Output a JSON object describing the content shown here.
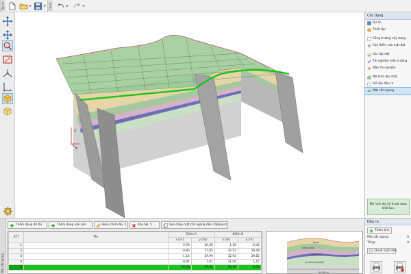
{
  "app": {
    "toolbar_tabs": [
      "Tệp tin",
      "Chỉnh"
    ],
    "toolbar_icons": [
      "new-file-icon",
      "open-folder-icon",
      "save-icon",
      "undo-icon",
      "redo-icon"
    ]
  },
  "left_tools": [
    {
      "name": "move-icon"
    },
    {
      "name": "pan-icon"
    },
    {
      "name": "zoom-window-icon"
    },
    {
      "name": "zoom-extents-icon"
    },
    {
      "name": "rotate-axes-icon"
    },
    {
      "name": "axes-xz-icon"
    },
    {
      "name": "cube-view-icon"
    },
    {
      "name": "cube-settings-icon"
    }
  ],
  "sidebar": {
    "header": "Các dạng",
    "groups": [
      [
        {
          "label": "Dự án",
          "icon": "project-icon"
        },
        {
          "label": "Thiết lập",
          "icon": "settings-icon"
        }
      ],
      [
        {
          "label": "Công trường xây dựng",
          "icon": "construction-site-icon"
        },
        {
          "label": "Các điểm của mặt đất",
          "icon": "terrain-points-icon"
        }
      ],
      [
        {
          "label": "Các lớp đất",
          "icon": "soil-layers-icon"
        },
        {
          "label": "Thí nghiệm hiện trường",
          "icon": "field-test-icon"
        },
        {
          "label": "Mẫu thí nghiệm",
          "icon": "sample-icon"
        }
      ],
      [
        {
          "label": "Mô hình địa chất",
          "icon": "geological-model-icon"
        },
        {
          "label": "Dữ liệu đầu ra",
          "icon": "output-data-icon"
        },
        {
          "label": "Mặt cắt ngang",
          "icon": "cross-section-icon",
          "selected": true
        }
      ]
    ],
    "note": "Mô hình địa kỹ thuật được khởi tạo."
  },
  "bottom": {
    "tab_label": "Mặt cắt ngang",
    "buttons": [
      {
        "label": "Thêm dạng đồ thị",
        "icon": "add-graphic-icon"
      },
      {
        "label": "Thêm dạng văn bản",
        "icon": "add-text-icon"
      },
      {
        "label": "Hiệu chỉnh No. 5",
        "icon": "edit-icon"
      },
      {
        "label": "Xóa No. 5",
        "icon": "delete-icon"
      },
      {
        "label": "Sao chép mặt cắt ngang đến Clipboard",
        "icon": "copy-clipboard-icon"
      }
    ],
    "table": {
      "col_stt": "STT",
      "col_name": "Tên",
      "col_point_a": "Điểm A",
      "col_point_b": "Điểm B",
      "sub_x": "x [m]",
      "sub_y": "y [m]",
      "rows": [
        {
          "stt": "1",
          "name": "",
          "ax": "0,78",
          "ay": "60,36",
          "bx": "1,29",
          "by": "-0,42"
        },
        {
          "stt": "2",
          "name": "",
          "ax": "-0,80",
          "ay": "57,85",
          "bx": "30,52",
          "by": "58,08"
        },
        {
          "stt": "3",
          "name": "",
          "ax": "-1,16",
          "ay": "29,99",
          "bx": "32,92",
          "by": "29,82"
        },
        {
          "stt": "4",
          "name": "",
          "ax": "-0,82",
          "ay": "1,91",
          "bx": "31,09",
          "by": "1,67"
        },
        {
          "stt": "5",
          "name": "",
          "ax": "16,38",
          "ay": "59,92",
          "bx": "16,49",
          "by": "-0,09",
          "active": true
        }
      ]
    },
    "preview": {
      "layer_labels": [
        "loess",
        "silty sand",
        "claystone",
        "(chưa khai báo)"
      ],
      "dimension": "59,80 m"
    },
    "output": {
      "header": "Đầu ra",
      "add_image": "Thêm ảnh",
      "cross_section_label": "Mặt cắt ngang :",
      "cross_section_value": "0",
      "total_label": "Tổng :",
      "total_value": "0",
      "image_list": "Danh sách ảnh"
    }
  },
  "colors": {
    "selection_green": "#17c417",
    "soil_green": "#9cc99a",
    "cross_section_gray": "#9b9b9b"
  }
}
